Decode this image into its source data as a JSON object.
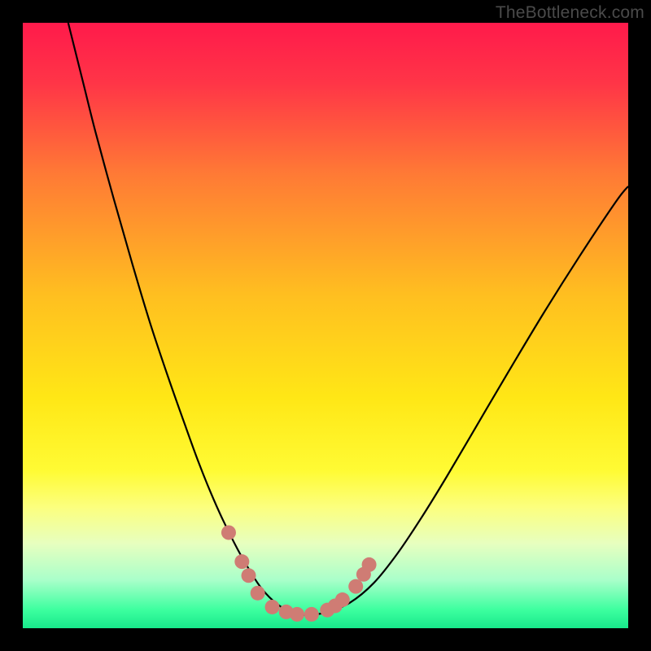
{
  "watermark": "TheBottleneck.com",
  "chart_data": {
    "type": "line",
    "title": "",
    "xlabel": "",
    "ylabel": "",
    "xlim": [
      0,
      100
    ],
    "ylim": [
      0,
      100
    ],
    "background_gradient": {
      "stops": [
        {
          "offset": 0.0,
          "color": "#ff1a4b"
        },
        {
          "offset": 0.1,
          "color": "#ff3547"
        },
        {
          "offset": 0.25,
          "color": "#ff7a35"
        },
        {
          "offset": 0.45,
          "color": "#ffbf20"
        },
        {
          "offset": 0.62,
          "color": "#ffe716"
        },
        {
          "offset": 0.74,
          "color": "#fffb34"
        },
        {
          "offset": 0.8,
          "color": "#fcff7e"
        },
        {
          "offset": 0.86,
          "color": "#e7ffbf"
        },
        {
          "offset": 0.92,
          "color": "#aaffca"
        },
        {
          "offset": 0.97,
          "color": "#3cff9f"
        },
        {
          "offset": 1.0,
          "color": "#18e98b"
        }
      ]
    },
    "series": [
      {
        "name": "bottleneck-curve",
        "color": "#000000",
        "x": [
          7.5,
          10,
          12,
          15,
          18,
          21,
          24,
          27,
          29,
          31,
          33,
          35.5,
          37.5,
          39.5,
          42,
          44.5,
          47,
          50,
          54,
          58,
          62,
          66,
          70,
          75,
          80,
          86,
          92,
          98,
          100
        ],
        "y": [
          100,
          90,
          82,
          71,
          60.5,
          50.5,
          41.5,
          33,
          27.5,
          22.5,
          18,
          13,
          9.5,
          6.5,
          4,
          2.6,
          2.2,
          2.6,
          4.2,
          7.5,
          12.5,
          18.5,
          25,
          33.5,
          42,
          52,
          61.5,
          70.5,
          73
        ]
      }
    ],
    "markers": {
      "name": "highlighted-points",
      "color": "#cf7c74",
      "radius": 9,
      "points": [
        {
          "x": 34.0,
          "y": 15.8
        },
        {
          "x": 36.2,
          "y": 11.0
        },
        {
          "x": 37.3,
          "y": 8.7
        },
        {
          "x": 38.8,
          "y": 5.8
        },
        {
          "x": 41.2,
          "y": 3.5
        },
        {
          "x": 43.5,
          "y": 2.7
        },
        {
          "x": 45.3,
          "y": 2.3
        },
        {
          "x": 47.7,
          "y": 2.3
        },
        {
          "x": 50.3,
          "y": 3.0
        },
        {
          "x": 51.6,
          "y": 3.7
        },
        {
          "x": 52.8,
          "y": 4.7
        },
        {
          "x": 55.0,
          "y": 6.9
        },
        {
          "x": 56.3,
          "y": 8.9
        },
        {
          "x": 57.2,
          "y": 10.5
        }
      ]
    }
  }
}
